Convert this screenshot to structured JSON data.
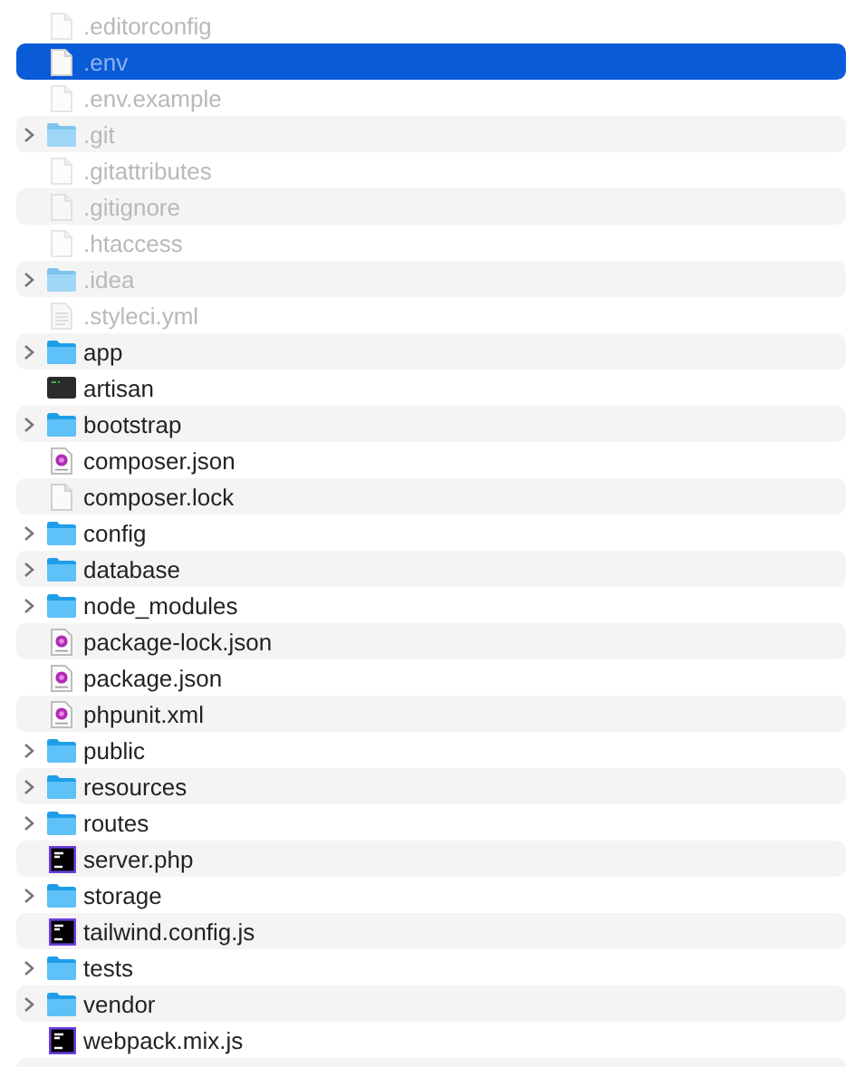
{
  "files": [
    {
      "name": ".editorconfig",
      "kind": "file",
      "hidden": true,
      "selected": false
    },
    {
      "name": ".env",
      "kind": "file",
      "hidden": true,
      "selected": true
    },
    {
      "name": ".env.example",
      "kind": "file",
      "hidden": true,
      "selected": false
    },
    {
      "name": ".git",
      "kind": "folder",
      "hidden": true,
      "selected": false
    },
    {
      "name": ".gitattributes",
      "kind": "file",
      "hidden": true,
      "selected": false
    },
    {
      "name": ".gitignore",
      "kind": "file",
      "hidden": true,
      "selected": false
    },
    {
      "name": ".htaccess",
      "kind": "file",
      "hidden": true,
      "selected": false
    },
    {
      "name": ".idea",
      "kind": "folder",
      "hidden": true,
      "selected": false
    },
    {
      "name": ".styleci.yml",
      "kind": "text",
      "hidden": true,
      "selected": false
    },
    {
      "name": "app",
      "kind": "folder",
      "hidden": false,
      "selected": false
    },
    {
      "name": "artisan",
      "kind": "terminal",
      "hidden": false,
      "selected": false
    },
    {
      "name": "bootstrap",
      "kind": "folder",
      "hidden": false,
      "selected": false
    },
    {
      "name": "composer.json",
      "kind": "purple",
      "hidden": false,
      "selected": false
    },
    {
      "name": "composer.lock",
      "kind": "file",
      "hidden": false,
      "selected": false
    },
    {
      "name": "config",
      "kind": "folder",
      "hidden": false,
      "selected": false
    },
    {
      "name": "database",
      "kind": "folder",
      "hidden": false,
      "selected": false
    },
    {
      "name": "node_modules",
      "kind": "folder",
      "hidden": false,
      "selected": false
    },
    {
      "name": "package-lock.json",
      "kind": "purple",
      "hidden": false,
      "selected": false
    },
    {
      "name": "package.json",
      "kind": "purple",
      "hidden": false,
      "selected": false
    },
    {
      "name": "phpunit.xml",
      "kind": "purple",
      "hidden": false,
      "selected": false
    },
    {
      "name": "public",
      "kind": "folder",
      "hidden": false,
      "selected": false
    },
    {
      "name": "resources",
      "kind": "folder",
      "hidden": false,
      "selected": false
    },
    {
      "name": "routes",
      "kind": "folder",
      "hidden": false,
      "selected": false
    },
    {
      "name": "server.php",
      "kind": "ide",
      "hidden": false,
      "selected": false
    },
    {
      "name": "storage",
      "kind": "folder",
      "hidden": false,
      "selected": false
    },
    {
      "name": "tailwind.config.js",
      "kind": "ide",
      "hidden": false,
      "selected": false
    },
    {
      "name": "tests",
      "kind": "folder",
      "hidden": false,
      "selected": false
    },
    {
      "name": "vendor",
      "kind": "folder",
      "hidden": false,
      "selected": false
    },
    {
      "name": "webpack.mix.js",
      "kind": "ide",
      "hidden": false,
      "selected": false
    }
  ]
}
